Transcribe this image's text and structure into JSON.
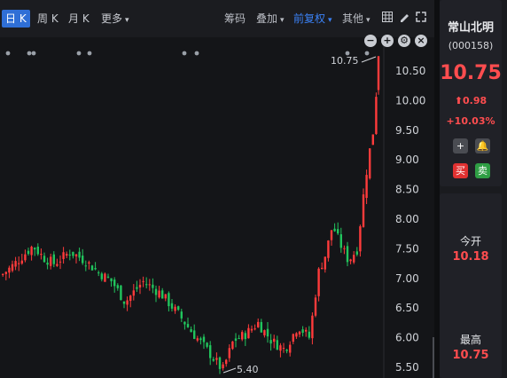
{
  "toolbar": {
    "tabs": [
      "日 K",
      "周 K",
      "月 K",
      "更多"
    ],
    "tools": [
      "筹码",
      "叠加",
      "前复权",
      "其他"
    ]
  },
  "chart_data": {
    "type": "candlestick",
    "y_ticks": [
      "10.50",
      "10.00",
      "9.50",
      "9.00",
      "8.50",
      "8.00",
      "7.50",
      "7.00",
      "6.50",
      "6.00",
      "5.50"
    ],
    "ylim": [
      5.4,
      10.75
    ],
    "high_label": "10.75",
    "low_label": "5.40",
    "colors": {
      "up": "#ff3b3b",
      "down": "#21c55d"
    }
  },
  "stock": {
    "name": "常山北明",
    "code": "(000158)",
    "price": "10.75",
    "change": "0.98",
    "change_pct": "+10.03%",
    "buy": "买",
    "sell": "卖"
  },
  "stats": {
    "open_label": "今开",
    "open_value": "10.18",
    "high_label": "最高",
    "high_value": "10.75"
  }
}
